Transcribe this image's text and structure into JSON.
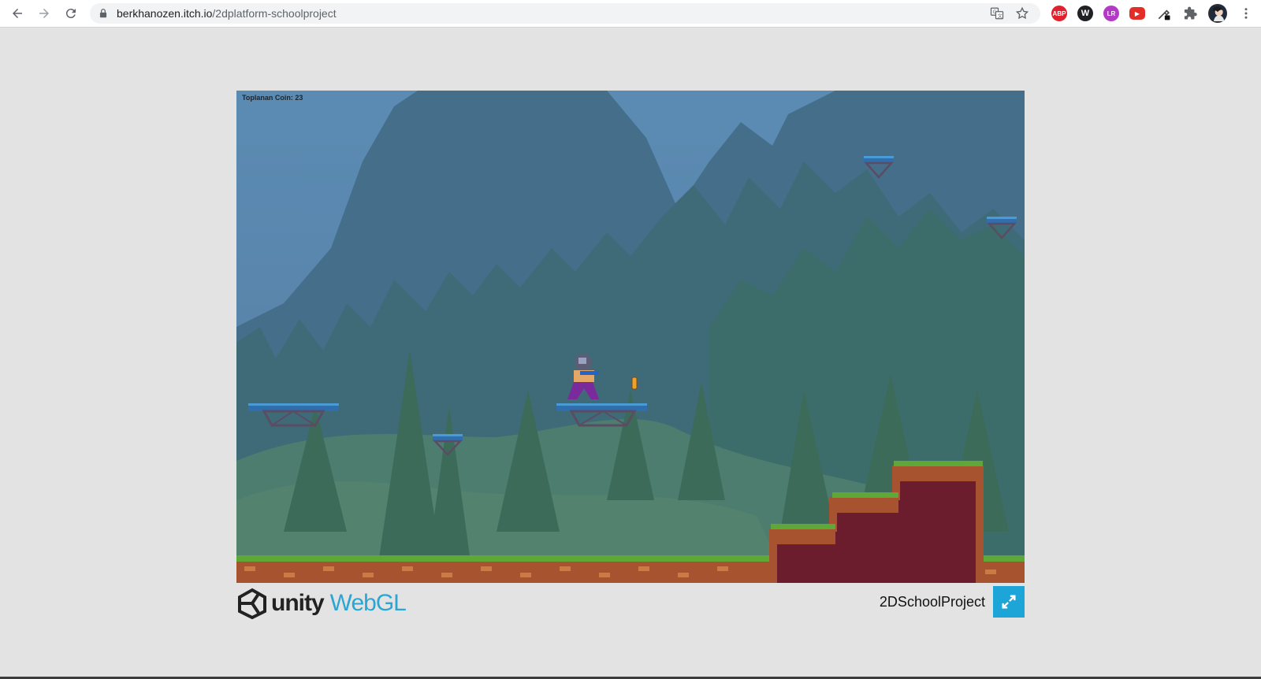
{
  "browser": {
    "url_domain": "berkhanozen.itch.io",
    "url_path": "/2dplatform-schoolproject",
    "nav_icons": [
      "back-arrow-icon",
      "forward-arrow-icon",
      "reload-icon"
    ],
    "omnibox_icons": [
      "lock-icon",
      "translate-icon",
      "star-icon"
    ],
    "extensions": [
      {
        "name": "adblock-plus-extension",
        "label": "ABP",
        "color": "#e2212f"
      },
      {
        "name": "extension-w",
        "label": "W",
        "color": "#202124"
      },
      {
        "name": "extension-lr",
        "label": "LR",
        "color": "#b23ac4"
      },
      {
        "name": "extension-youtube",
        "label": "▶",
        "color": "#e52d27"
      },
      {
        "name": "extension-eyedropper",
        "label": "",
        "color": "#444444"
      },
      {
        "name": "extensions-puzzle",
        "label": "",
        "color": "#5f6368"
      }
    ]
  },
  "game": {
    "hud_text": "Toplanan Coin: 23"
  },
  "footer": {
    "unity_text": "unity",
    "webgl_text": "WebGL",
    "project_title": "2DSchoolProject",
    "fullscreen_icon": "fullscreen-expand-icon"
  },
  "colors": {
    "accent": "#1ea5d8",
    "page_bg": "#e3e3e3"
  }
}
